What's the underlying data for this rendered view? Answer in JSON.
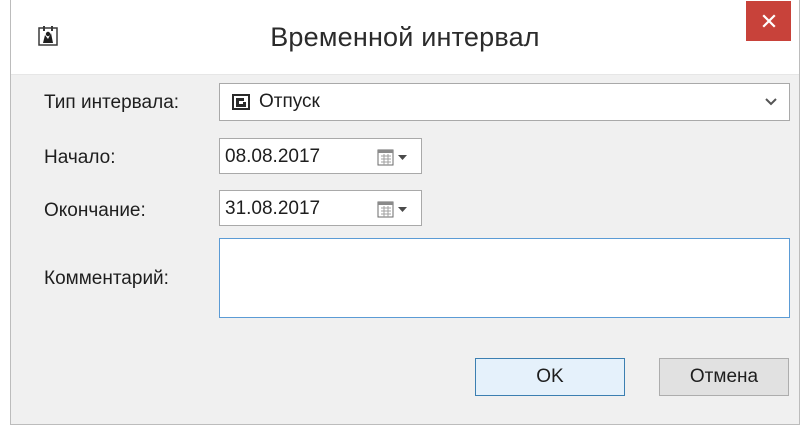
{
  "window": {
    "title": "Временной интервал",
    "close_label": "×"
  },
  "form": {
    "interval_type": {
      "label": "Тип интервала:",
      "value": "Отпуск"
    },
    "start": {
      "label": "Начало:",
      "value": "08.08.2017"
    },
    "end": {
      "label": "Окончание:",
      "value": "31.08.2017"
    },
    "comment": {
      "label": "Комментарий:",
      "value": ""
    }
  },
  "buttons": {
    "ok_label": "OK",
    "cancel_label": "Отмена"
  },
  "icons": {
    "app": "app-icon",
    "interval_type": "vacation-type-icon",
    "dropdown": "chevron-down-icon",
    "calendar": "calendar-icon"
  },
  "colors": {
    "close_button": "#c8423a",
    "client_background": "#f0f0f0",
    "focus_border": "#5b9bd5"
  }
}
